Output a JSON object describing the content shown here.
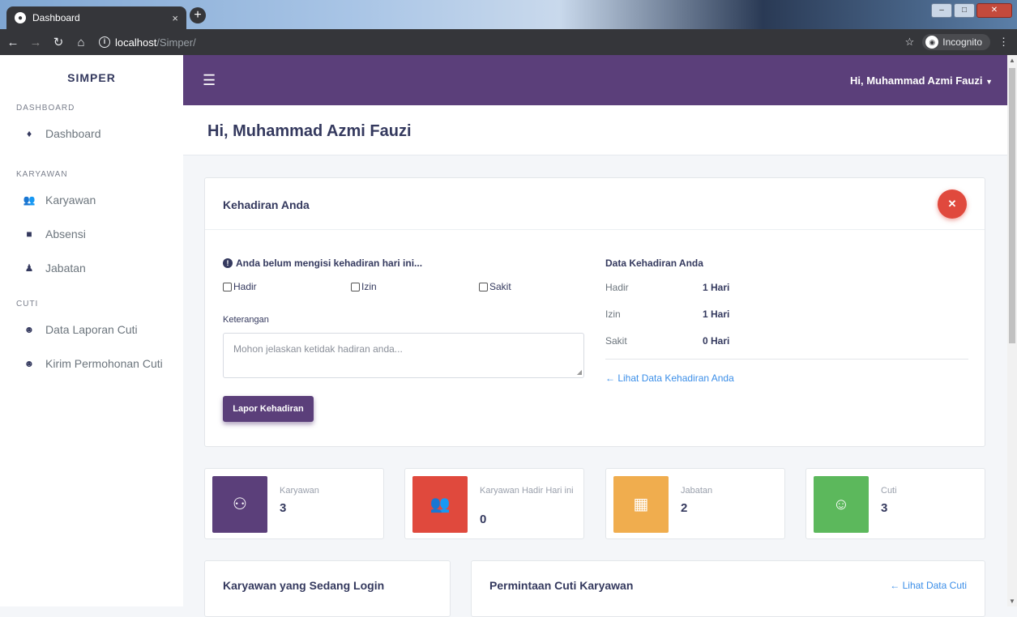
{
  "browser": {
    "tab_title": "Dashboard",
    "tab_close": "×",
    "new_tab": "+",
    "url_host": "localhost",
    "url_path": "/Simper/",
    "incognito_label": "Incognito"
  },
  "sidebar": {
    "brand": "SIMPER",
    "sections": [
      {
        "header": "DASHBOARD",
        "items": [
          {
            "label": "Dashboard",
            "icon": "fire-icon"
          }
        ]
      },
      {
        "header": "KARYAWAN",
        "items": [
          {
            "label": "Karyawan",
            "icon": "users-icon"
          },
          {
            "label": "Absensi",
            "icon": "clipboard-icon"
          },
          {
            "label": "Jabatan",
            "icon": "user-tie-icon"
          }
        ]
      },
      {
        "header": "CUTI",
        "items": [
          {
            "label": "Data Laporan Cuti",
            "icon": "smile-icon"
          },
          {
            "label": "Kirim Permohonan Cuti",
            "icon": "smile-icon"
          }
        ]
      }
    ]
  },
  "topnav": {
    "user_label": "Hi, Muhammad Azmi Fauzi"
  },
  "page": {
    "title": "Hi, Muhammad Azmi Fauzi"
  },
  "attendance": {
    "title": "Kehadiran Anda",
    "warning": "Anda belum mengisi kehadiran hari ini...",
    "options": [
      "Hadir",
      "Izin",
      "Sakit"
    ],
    "note_label": "Keterangan",
    "note_placeholder": "Mohon jelaskan ketidak hadiran anda...",
    "submit_label": "Lapor Kehadiran",
    "stats_title": "Data Kehadiran Anda",
    "stats": [
      {
        "label": "Hadir",
        "value": "1 Hari"
      },
      {
        "label": "Izin",
        "value": "1 Hari"
      },
      {
        "label": "Sakit",
        "value": "0 Hari"
      }
    ],
    "view_link": "← Lihat Data Kehadiran Anda"
  },
  "summary_cards": [
    {
      "label": "Karyawan",
      "value": "3",
      "color": "#5b3f7a",
      "icon": "user-icon"
    },
    {
      "label": "Karyawan Hadir Hari ini",
      "value": "0",
      "color": "#e0493d",
      "icon": "users-icon"
    },
    {
      "label": "Jabatan",
      "value": "2",
      "color": "#f0ad4e",
      "icon": "building-icon"
    },
    {
      "label": "Cuti",
      "value": "3",
      "color": "#5cb85c",
      "icon": "smile-icon"
    }
  ],
  "bottom": {
    "login_title": "Karyawan yang Sedang Login",
    "cuti_title": "Permintaan Cuti Karyawan",
    "cuti_link": "← Lihat Data Cuti"
  },
  "colors": {
    "topnav": "#5b3f7a",
    "danger": "#e0493d",
    "link": "#3b8ee8"
  }
}
